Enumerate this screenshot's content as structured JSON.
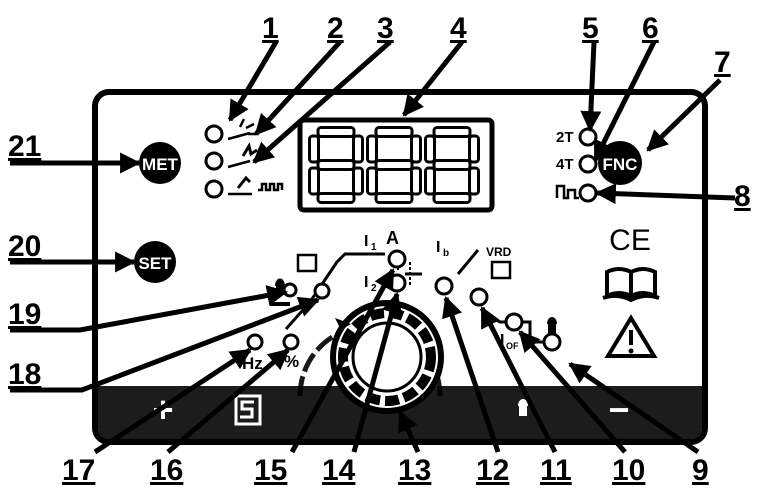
{
  "numbers": [
    "1",
    "2",
    "3",
    "4",
    "5",
    "6",
    "7",
    "8",
    "9",
    "10",
    "11",
    "12",
    "13",
    "14",
    "15",
    "16",
    "17",
    "18",
    "19",
    "20",
    "21"
  ],
  "buttons": {
    "met": "MET",
    "fnc": "FNC",
    "set": "SET"
  },
  "display": {
    "value": "888"
  },
  "trigger_modes": {
    "two_t": "2T",
    "four_t": "4T"
  },
  "params": {
    "i1": "I",
    "i1_sub": "1",
    "amp": "A",
    "i2": "I",
    "i2_sub": "2",
    "ib": "I",
    "ib_sub": "b",
    "vrd": "VRD",
    "iof": "I",
    "iof_sub": "OF",
    "hz": "Hz",
    "pct": "%"
  },
  "marks": {
    "ce": "CE"
  },
  "bottom_bar": {
    "plus": "+",
    "minus": "−"
  }
}
